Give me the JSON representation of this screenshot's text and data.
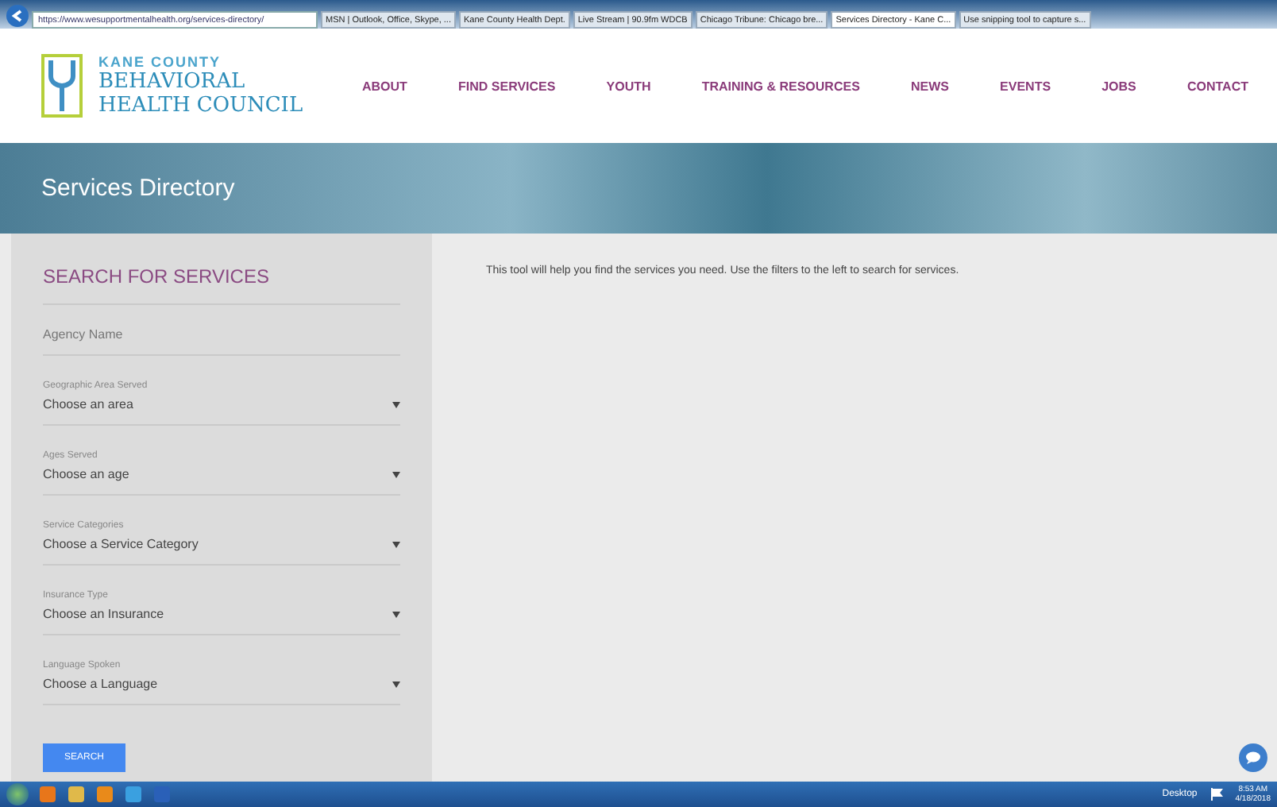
{
  "browser": {
    "address": "https://www.wesupportmentalhealth.org/services-directory/",
    "tabs": [
      {
        "label": "MSN | Outlook, Office, Skype, ...",
        "selected": false
      },
      {
        "label": "Kane County Health Dept.",
        "selected": false
      },
      {
        "label": "Live Stream | 90.9fm WDCB",
        "selected": false
      },
      {
        "label": "Chicago Tribune: Chicago bre...",
        "selected": false
      },
      {
        "label": "Services Directory - Kane C...",
        "selected": true
      },
      {
        "label": "Use snipping tool to capture s...",
        "selected": false
      }
    ]
  },
  "logo": {
    "line_1": "KANE COUNTY",
    "line_2": "BEHAVIORAL",
    "line_3": "HEALTH COUNCIL"
  },
  "nav": [
    "ABOUT",
    "FIND SERVICES",
    "YOUTH",
    "TRAINING & RESOURCES",
    "NEWS",
    "EVENTS",
    "JOBS",
    "CONTACT"
  ],
  "banner": {
    "title": "Services Directory"
  },
  "sidebar": {
    "heading": "SEARCH FOR SERVICES",
    "fields": [
      {
        "kind": "text",
        "placeholder": "Agency Name"
      },
      {
        "kind": "select",
        "label": "Geographic Area Served",
        "value": "Choose an area"
      },
      {
        "kind": "select",
        "label": "Ages Served",
        "value": "Choose an age"
      },
      {
        "kind": "select",
        "label": "Service Categories",
        "value": "Choose a Service Category"
      },
      {
        "kind": "select",
        "label": "Insurance Type",
        "value": "Choose an Insurance"
      },
      {
        "kind": "select",
        "label": "Language Spoken",
        "value": "Choose a Language"
      }
    ],
    "button": "SEARCH"
  },
  "main": {
    "intro": "This tool will help you find the services you need. Use the filters to the left to search for services."
  },
  "taskbar": {
    "desktop": "Desktop",
    "time": "8:53 AM",
    "date": "4/18/2018"
  }
}
